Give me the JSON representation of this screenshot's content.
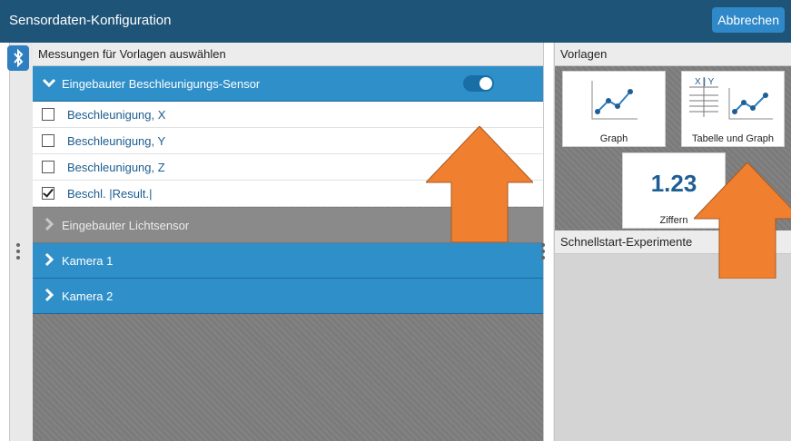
{
  "app": {
    "title": "Sensordaten-Konfiguration",
    "cancel_label": "Abbrechen",
    "accent": "#2f8fc9",
    "header_color": "#1f5479"
  },
  "left": {
    "header": "Messungen für Vorlagen auswählen",
    "sensor_group": {
      "label": "Eingebauter Beschleunigungs-Sensor",
      "toggle_on": true,
      "items": [
        {
          "label": "Beschleunigung, X",
          "checked": false
        },
        {
          "label": "Beschleunigung, Y",
          "checked": false
        },
        {
          "label": "Beschleunigung, Z",
          "checked": false
        },
        {
          "label": "Beschl. |Result.|",
          "checked": true
        }
      ]
    },
    "light_sensor": {
      "label": "Eingebauter Lichtsensor"
    },
    "camera1": {
      "label": "Kamera 1"
    },
    "camera2": {
      "label": "Kamera 2"
    }
  },
  "right": {
    "templates_header": "Vorlagen",
    "tiles": [
      {
        "label": "Graph"
      },
      {
        "label": "Tabelle und Graph",
        "table_head": "X | Y"
      },
      {
        "label": "Ziffern",
        "value": "1.23"
      }
    ],
    "quickstart_header": "Schnellstart-Experimente"
  },
  "icons": [
    "bluetooth-icon",
    "chevron-down-icon",
    "chevron-right-icon",
    "graph-icon",
    "table-graph-icon",
    "more-vertical-icon",
    "arrow-up-icon"
  ]
}
